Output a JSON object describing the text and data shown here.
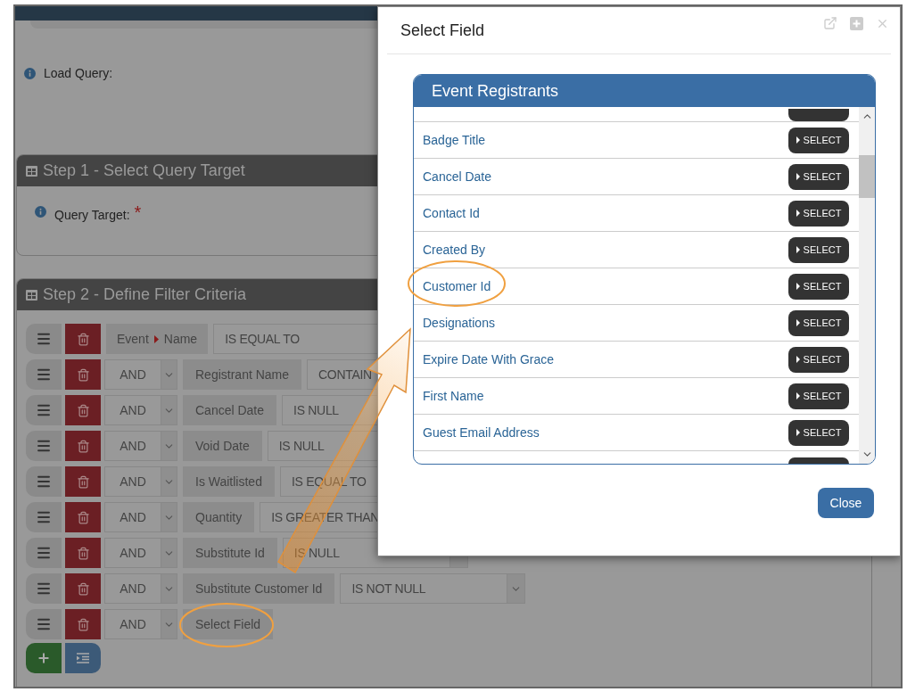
{
  "page": {
    "load_query": {
      "label": "Load Query:"
    },
    "step1": {
      "title": "Step 1 - Select Query Target",
      "query_target_label": "Query Target:",
      "required_mark": "*"
    },
    "step2": {
      "title": "Step 2 - Define Filter Criteria",
      "filters": [
        {
          "kind": "first",
          "parent": "Event",
          "field": "Name",
          "operator": "IS EQUAL TO"
        },
        {
          "kind": "joined",
          "conjunction": "AND",
          "field": "Registrant Name",
          "operator": "CONTAIN"
        },
        {
          "kind": "joined",
          "conjunction": "AND",
          "field": "Cancel Date",
          "operator": "IS NULL"
        },
        {
          "kind": "joined",
          "conjunction": "AND",
          "field": "Void Date",
          "operator": "IS NULL"
        },
        {
          "kind": "joined",
          "conjunction": "AND",
          "field": "Is Waitlisted",
          "operator": "IS EQUAL TO"
        },
        {
          "kind": "joined",
          "conjunction": "AND",
          "field": "Quantity",
          "operator": "IS GREATER THAN"
        },
        {
          "kind": "joined",
          "conjunction": "AND",
          "field": "Substitute Id",
          "operator": "IS NULL"
        },
        {
          "kind": "joined",
          "conjunction": "AND",
          "field": "Substitute Customer Id",
          "operator": "IS NOT NULL"
        },
        {
          "kind": "joined",
          "conjunction": "AND",
          "field": "Select Field"
        }
      ]
    }
  },
  "dialog": {
    "title": "Select Field",
    "list_title": "Event Registrants",
    "fields": [
      {
        "kind": "partial-top"
      },
      {
        "kind": "field",
        "name": "Badge Title",
        "button": "SELECT"
      },
      {
        "kind": "field",
        "name": "Cancel Date",
        "button": "SELECT"
      },
      {
        "kind": "field",
        "name": "Contact Id",
        "button": "SELECT"
      },
      {
        "kind": "field",
        "name": "Created By",
        "button": "SELECT"
      },
      {
        "kind": "field",
        "name": "Customer Id",
        "button": "SELECT"
      },
      {
        "kind": "field",
        "name": "Designations",
        "button": "SELECT"
      },
      {
        "kind": "field",
        "name": "Expire Date With Grace",
        "button": "SELECT"
      },
      {
        "kind": "field",
        "name": "First Name",
        "button": "SELECT"
      },
      {
        "kind": "field",
        "name": "Guest Email Address",
        "button": "SELECT"
      },
      {
        "kind": "partial-bottom"
      }
    ],
    "close_button": "Close"
  }
}
